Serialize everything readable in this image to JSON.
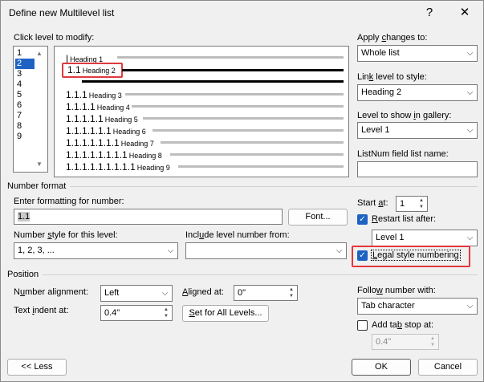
{
  "window": {
    "title": "Define new Multilevel list",
    "help_glyph": "?",
    "close_glyph": "✕"
  },
  "levels": {
    "label": "Click level to modify:",
    "items": [
      "1",
      "2",
      "3",
      "4",
      "5",
      "6",
      "7",
      "8",
      "9"
    ],
    "selected": "2"
  },
  "preview": {
    "rows": [
      {
        "num": "",
        "heading": "Heading 1"
      },
      {
        "num": "1.1",
        "heading": "Heading 2"
      },
      {
        "num": "1.1.1",
        "heading": "Heading 3"
      },
      {
        "num": "1.1.1.1",
        "heading": "Heading 4"
      },
      {
        "num": "1.1.1.1.1",
        "heading": "Heading 5"
      },
      {
        "num": "1.1.1.1.1.1",
        "heading": "Heading 6"
      },
      {
        "num": "1.1.1.1.1.1.1",
        "heading": "Heading 7"
      },
      {
        "num": "1.1.1.1.1.1.1.1",
        "heading": "Heading 8"
      },
      {
        "num": "1.1.1.1.1.1.1.1.1",
        "heading": "Heading 9"
      }
    ]
  },
  "apply": {
    "label": "Apply changes to:",
    "value": "Whole list"
  },
  "link": {
    "label": "Link level to style:",
    "value": "Heading 2"
  },
  "gallery": {
    "label": "Level to show in gallery:",
    "value": "Level 1"
  },
  "listnum": {
    "label": "ListNum field list name:",
    "value": ""
  },
  "number_format": {
    "section": "Number format",
    "format_label": "Enter formatting for number:",
    "format_value": "1.1",
    "font_button": "Font...",
    "style_label": "Number style for this level:",
    "style_value": "1, 2, 3, ...",
    "include_label": "Include level number from:",
    "include_value": ""
  },
  "start": {
    "label": "Start at:",
    "value": "1",
    "restart_label": "Restart list after:",
    "restart_value": "Level 1",
    "legal_label": "Legal style numbering"
  },
  "position": {
    "section": "Position",
    "alignment_label": "Number alignment:",
    "alignment_value": "Left",
    "aligned_at_label": "Aligned at:",
    "aligned_at_value": "0\"",
    "indent_label": "Text indent at:",
    "indent_value": "0.4\"",
    "set_all_button": "Set for All Levels...",
    "follow_label": "Follow number with:",
    "follow_value": "Tab character",
    "tab_stop_label": "Add tab stop at:",
    "tab_stop_value": "0.4\""
  },
  "buttons": {
    "less": "<< Less",
    "ok": "OK",
    "cancel": "Cancel"
  },
  "colors": {
    "accent": "#1e63c4",
    "highlight": "#e0383e"
  }
}
